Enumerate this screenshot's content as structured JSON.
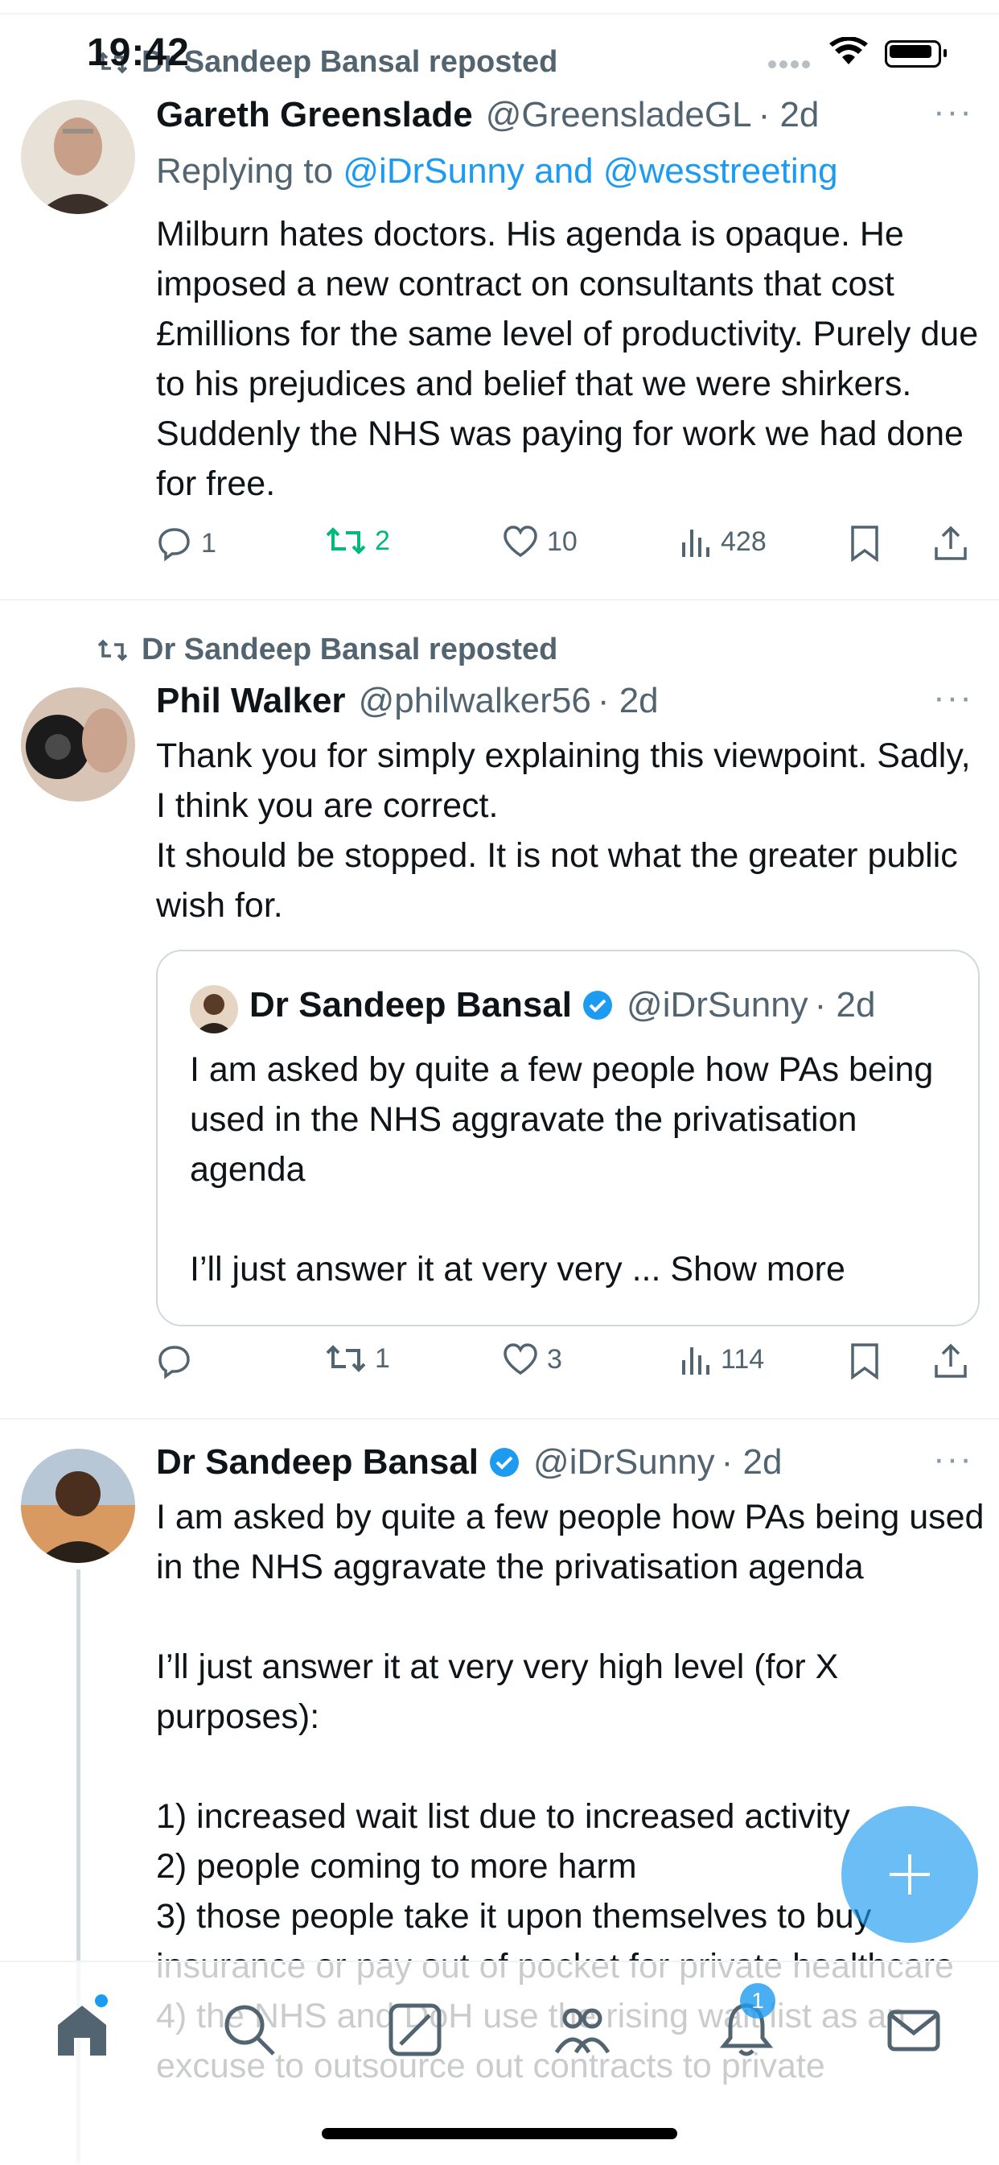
{
  "status_bar": {
    "time": "19:42"
  },
  "tweets": [
    {
      "repost_label": "Dr Sandeep Bansal reposted",
      "name": "Gareth Greenslade",
      "handle": "@GreensladeGL",
      "time": "· 2d",
      "reply_prefix": "Replying to",
      "reply_mentions": "@iDrSunny and @wesstreeting",
      "text": "Milburn hates doctors. His agenda is opaque. He imposed a new contract on consultants that cost £millions for the same level of productivity. Purely due to his prejudices and belief that we were shirkers. Suddenly the NHS was paying for work we had done for free.",
      "replies": "1",
      "reposts": "2",
      "likes": "10",
      "views": "428"
    },
    {
      "repost_label": "Dr Sandeep Bansal reposted",
      "name": "Phil Walker",
      "handle": "@philwalker56",
      "time": "· 2d",
      "text": "Thank you for simply explaining this viewpoint. Sadly, I think you are correct.\nIt should be stopped. It is not what the greater public wish for.",
      "quote": {
        "name": "Dr Sandeep Bansal",
        "handle": "@iDrSunny",
        "time": "· 2d",
        "text": "I am asked by quite a few people how PAs being used in the NHS aggravate the privatisation agenda\n\nI’ll just answer it at very very ...",
        "show_more": "Show more"
      },
      "replies": "",
      "reposts": "1",
      "likes": "3",
      "views": "114"
    },
    {
      "name": "Dr Sandeep Bansal",
      "handle": "@iDrSunny",
      "time": "· 2d",
      "text": "I am asked by quite a few people how PAs being used in the NHS aggravate the privatisation agenda\n\nI’ll just answer it at very very high level (for X purposes):\n\n1) increased wait list due to increased activity\n2) people coming to more harm\n3) those people take it upon themselves to buy insurance or pay out of pocket for private healthcare\n4) the NHS and DoH use the rising wait list as an excuse to outsource out contracts to private"
    }
  ],
  "tab_bar": {
    "tabs": [
      "home-icon",
      "search-icon",
      "grok-icon",
      "communities-icon",
      "notifications-icon",
      "messages-icon"
    ],
    "notification_count": "1"
  },
  "colors": {
    "accent": "#1d9bf0",
    "repost_green": "#00ba7c",
    "muted": "#536471"
  }
}
